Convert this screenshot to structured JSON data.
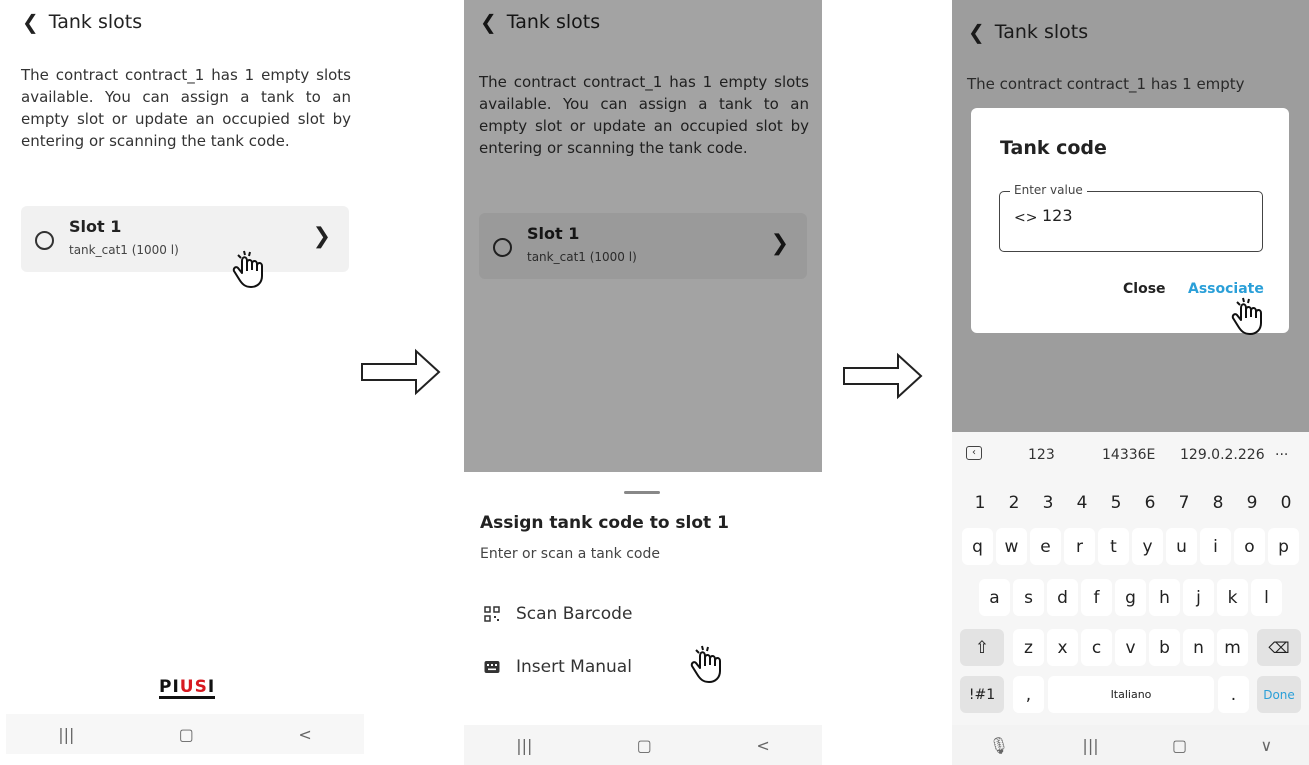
{
  "screen1": {
    "title": "Tank slots",
    "description": "The contract contract_1 has 1 empty slots available. You can assign a tank to an empty slot or update an occupied slot by entering or scanning the tank code.",
    "slot": {
      "title": "Slot 1",
      "subtitle": "tank_cat1 (1000 l)"
    },
    "logo": {
      "part1": "PI",
      "part2": "US",
      "part3": "I"
    },
    "nav": [
      "|||",
      "▢",
      "<"
    ]
  },
  "screen2": {
    "title": "Tank slots",
    "description": "The contract contract_1 has 1 empty slots available. You can assign a tank to an empty slot or update an occupied slot by entering or scanning the tank code.",
    "slot": {
      "title": "Slot 1",
      "subtitle": "tank_cat1 (1000 l)"
    },
    "sheet": {
      "title": "Assign tank code to slot 1",
      "subtitle": "Enter or scan a tank code",
      "option_scan": "Scan Barcode",
      "option_manual": "Insert Manual"
    },
    "nav": [
      "|||",
      "▢",
      "<"
    ]
  },
  "screen3": {
    "title": "Tank slots",
    "description_fragment": "The contract contract_1 has 1 empty",
    "dialog": {
      "title": "Tank code",
      "field_label": "Enter value",
      "field_value": "123",
      "close_label": "Close",
      "associate_label": "Associate"
    },
    "keyboard": {
      "suggestions": [
        "123",
        "14336E",
        "129.0.2.226",
        "···"
      ],
      "row_numbers": [
        "1",
        "2",
        "3",
        "4",
        "5",
        "6",
        "7",
        "8",
        "9",
        "0"
      ],
      "row_q": [
        "q",
        "w",
        "e",
        "r",
        "t",
        "y",
        "u",
        "i",
        "o",
        "p"
      ],
      "row_a": [
        "a",
        "s",
        "d",
        "f",
        "g",
        "h",
        "j",
        "k",
        "l"
      ],
      "row_z": [
        "z",
        "x",
        "c",
        "v",
        "b",
        "n",
        "m"
      ],
      "symbols_label": "!#1",
      "comma_label": ",",
      "space_label": "Italiano",
      "period_label": ".",
      "done_label": "Done"
    },
    "nav": [
      "🎙",
      "|||",
      "▢",
      "∨"
    ]
  },
  "colors": {
    "accent": "#2a9fd8",
    "dim_overlay": "#9e9e9e",
    "logo_red": "#d71920"
  }
}
